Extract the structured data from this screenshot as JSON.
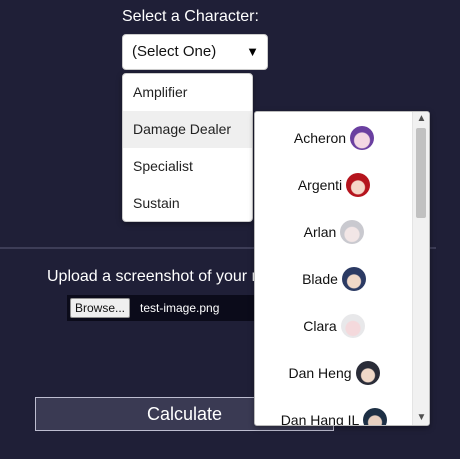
{
  "character_select": {
    "label": "Select a Character:",
    "selected": "(Select One)",
    "caret": "▼"
  },
  "role_menu": {
    "items": [
      {
        "label": "Amplifier",
        "active": false
      },
      {
        "label": "Damage Dealer",
        "active": true
      },
      {
        "label": "Specialist",
        "active": false
      },
      {
        "label": "Sustain",
        "active": false
      }
    ]
  },
  "character_list": {
    "items": [
      {
        "name": "Acheron",
        "icon": "acheron-avatar-icon"
      },
      {
        "name": "Argenti",
        "icon": "argenti-avatar-icon"
      },
      {
        "name": "Arlan",
        "icon": "arlan-avatar-icon"
      },
      {
        "name": "Blade",
        "icon": "blade-avatar-icon"
      },
      {
        "name": "Clara",
        "icon": "clara-avatar-icon"
      },
      {
        "name": "Dan Heng",
        "icon": "dan-heng-avatar-icon"
      },
      {
        "name": "Dan Hang IL",
        "icon": "dan-heng-il-avatar-icon"
      }
    ],
    "scroll_up": "▲",
    "scroll_down": "▼"
  },
  "upload": {
    "label": "Upload a screenshot of your r",
    "browse_label": "Browse...",
    "file_name": "test-image.png"
  },
  "calculate": {
    "label": "Calculate"
  },
  "colors": {
    "background": "#1f1f37",
    "button": "#3a3a53"
  }
}
